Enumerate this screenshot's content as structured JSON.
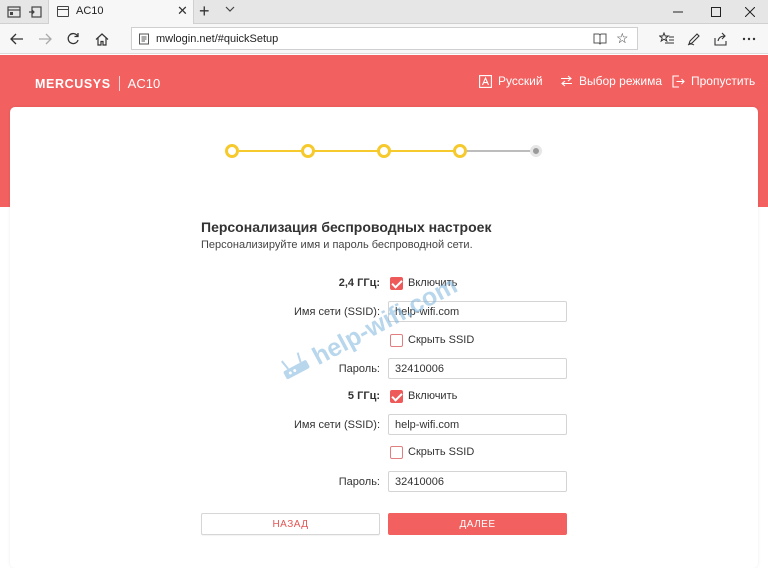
{
  "browser": {
    "tab_title": "AC10",
    "url": "mwlogin.net/#quickSetup"
  },
  "header": {
    "brand_logo": "MERCUSYS",
    "model": "AC10",
    "language_link": "Русский",
    "mode_link": "Выбор режима",
    "skip_link": "Пропустить"
  },
  "steps": {
    "total": 5,
    "completed": 4
  },
  "form": {
    "title": "Персонализация беспроводных настроек",
    "subtitle": "Персонализируйте имя и пароль беспроводной сети.",
    "band_24": {
      "label": "2,4 ГГц:",
      "enable_label": "Включить",
      "enabled": true,
      "ssid_label": "Имя сети (SSID):",
      "ssid_value": "help-wifi.com",
      "hide_ssid_label": "Скрыть SSID",
      "hide_ssid": false,
      "password_label": "Пароль:",
      "password_value": "32410006"
    },
    "band_5": {
      "label": "5 ГГц:",
      "enable_label": "Включить",
      "enabled": true,
      "ssid_label": "Имя сети (SSID):",
      "ssid_value": "help-wifi.com",
      "hide_ssid_label": "Скрыть SSID",
      "hide_ssid": false,
      "password_label": "Пароль:",
      "password_value": "32410006"
    },
    "back_button": "НАЗАД",
    "next_button": "ДАЛЕЕ"
  },
  "watermark": "help-wifi.com",
  "colors": {
    "brand_red": "#f26060",
    "step_yellow": "#f6c92d",
    "checkbox_red": "#ee5a5a"
  }
}
